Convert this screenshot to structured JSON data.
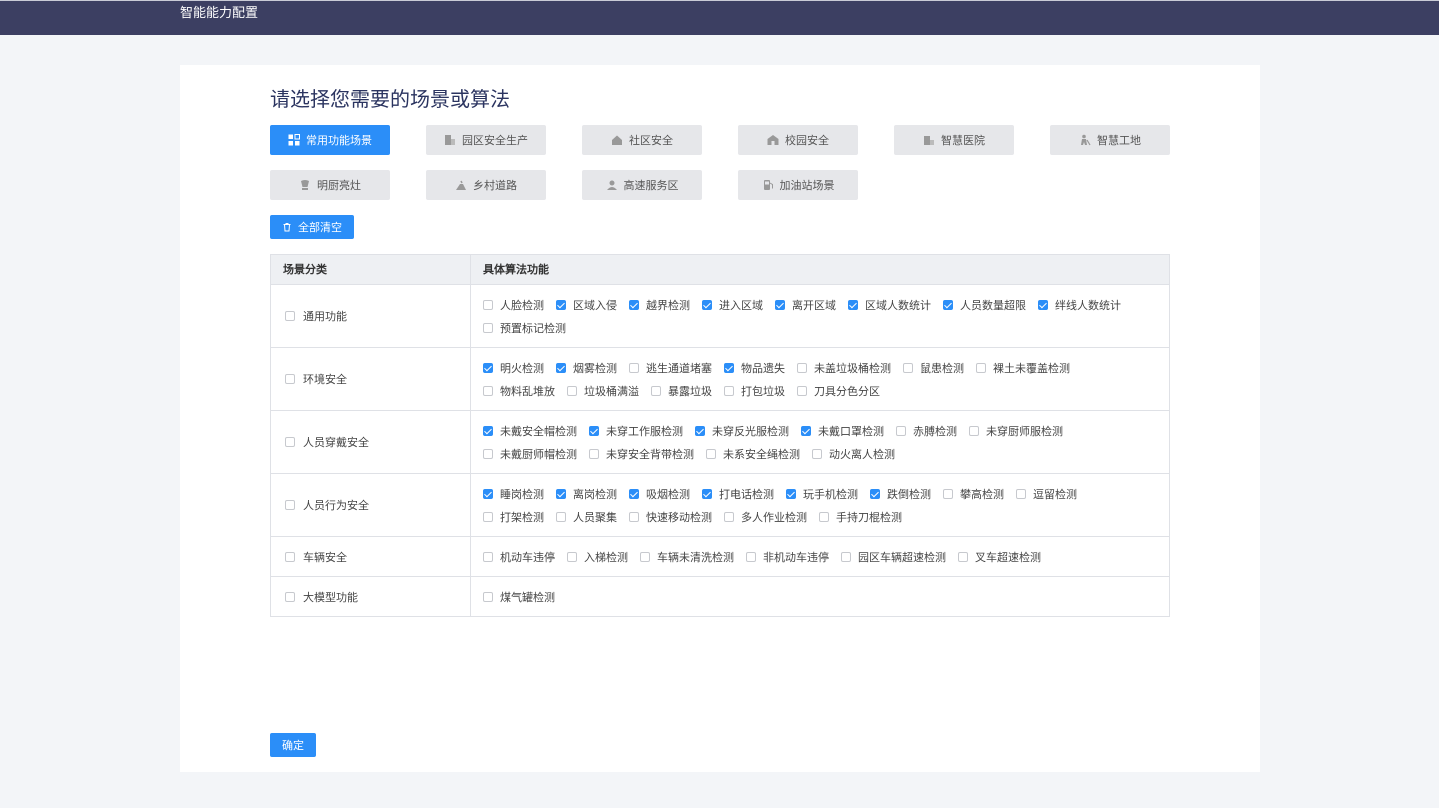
{
  "topbar": {
    "title": "智能能力配置"
  },
  "heading": "请选择您需要的场景或算法",
  "scenes": [
    {
      "label": "常用功能场景",
      "icon": "grid-shapes-icon",
      "active": true
    },
    {
      "label": "园区安全生产",
      "icon": "factory-building-icon",
      "active": false
    },
    {
      "label": "社区安全",
      "icon": "house-icon",
      "active": false
    },
    {
      "label": "校园安全",
      "icon": "school-icon",
      "active": false
    },
    {
      "label": "智慧医院",
      "icon": "hospital-icon",
      "active": false
    },
    {
      "label": "智慧工地",
      "icon": "construction-worker-icon",
      "active": false
    },
    {
      "label": "明厨亮灶",
      "icon": "chef-hat-icon",
      "active": false
    },
    {
      "label": "乡村道路",
      "icon": "road-icon",
      "active": false
    },
    {
      "label": "高速服务区",
      "icon": "service-area-icon",
      "active": false
    },
    {
      "label": "加油站场景",
      "icon": "fuel-pump-icon",
      "active": false
    }
  ],
  "clear_button": {
    "label": "全部清空",
    "icon": "trash-icon"
  },
  "table": {
    "headers": [
      "场景分类",
      "具体算法功能"
    ],
    "rows": [
      {
        "category": "通用功能",
        "checked": false,
        "options": [
          {
            "label": "人脸检测",
            "checked": false
          },
          {
            "label": "区域入侵",
            "checked": true
          },
          {
            "label": "越界检测",
            "checked": true
          },
          {
            "label": "进入区域",
            "checked": true
          },
          {
            "label": "离开区域",
            "checked": true
          },
          {
            "label": "区域人数统计",
            "checked": true
          },
          {
            "label": "人员数量超限",
            "checked": true
          },
          {
            "label": "绊线人数统计",
            "checked": true
          },
          {
            "label": "预置标记检测",
            "checked": false
          }
        ]
      },
      {
        "category": "环境安全",
        "checked": false,
        "options": [
          {
            "label": "明火检测",
            "checked": true
          },
          {
            "label": "烟雾检测",
            "checked": true
          },
          {
            "label": "逃生通道堵塞",
            "checked": false
          },
          {
            "label": "物品遗失",
            "checked": true
          },
          {
            "label": "未盖垃圾桶检测",
            "checked": false
          },
          {
            "label": "鼠患检测",
            "checked": false
          },
          {
            "label": "裸土未覆盖检测",
            "checked": false
          },
          {
            "label": "物料乱堆放",
            "checked": false
          },
          {
            "label": "垃圾桶满溢",
            "checked": false
          },
          {
            "label": "暴露垃圾",
            "checked": false
          },
          {
            "label": "打包垃圾",
            "checked": false
          },
          {
            "label": "刀具分色分区",
            "checked": false
          }
        ]
      },
      {
        "category": "人员穿戴安全",
        "checked": false,
        "options": [
          {
            "label": "未戴安全帽检测",
            "checked": true
          },
          {
            "label": "未穿工作服检测",
            "checked": true
          },
          {
            "label": "未穿反光服检测",
            "checked": true
          },
          {
            "label": "未戴口罩检测",
            "checked": true
          },
          {
            "label": "赤膊检测",
            "checked": false
          },
          {
            "label": "未穿厨师服检测",
            "checked": false
          },
          {
            "label": "未戴厨师帽检测",
            "checked": false
          },
          {
            "label": "未穿安全背带检测",
            "checked": false
          },
          {
            "label": "未系安全绳检测",
            "checked": false
          },
          {
            "label": "动火离人检测",
            "checked": false
          }
        ]
      },
      {
        "category": "人员行为安全",
        "checked": false,
        "options": [
          {
            "label": "睡岗检测",
            "checked": true
          },
          {
            "label": "离岗检测",
            "checked": true
          },
          {
            "label": "吸烟检测",
            "checked": true
          },
          {
            "label": "打电话检测",
            "checked": true
          },
          {
            "label": "玩手机检测",
            "checked": true
          },
          {
            "label": "跌倒检测",
            "checked": true
          },
          {
            "label": "攀高检测",
            "checked": false
          },
          {
            "label": "逗留检测",
            "checked": false
          },
          {
            "label": "打架检测",
            "checked": false
          },
          {
            "label": "人员聚集",
            "checked": false
          },
          {
            "label": "快速移动检测",
            "checked": false
          },
          {
            "label": "多人作业检测",
            "checked": false
          },
          {
            "label": "手持刀棍检测",
            "checked": false
          }
        ]
      },
      {
        "category": "车辆安全",
        "checked": false,
        "options": [
          {
            "label": "机动车违停",
            "checked": false
          },
          {
            "label": "入梯检测",
            "checked": false
          },
          {
            "label": "车辆未清洗检测",
            "checked": false
          },
          {
            "label": "非机动车违停",
            "checked": false
          },
          {
            "label": "园区车辆超速检测",
            "checked": false
          },
          {
            "label": "叉车超速检测",
            "checked": false
          }
        ]
      },
      {
        "category": "大模型功能",
        "checked": false,
        "options": [
          {
            "label": "煤气罐检测",
            "checked": false
          }
        ]
      }
    ]
  },
  "confirm_button": {
    "label": "确定"
  }
}
